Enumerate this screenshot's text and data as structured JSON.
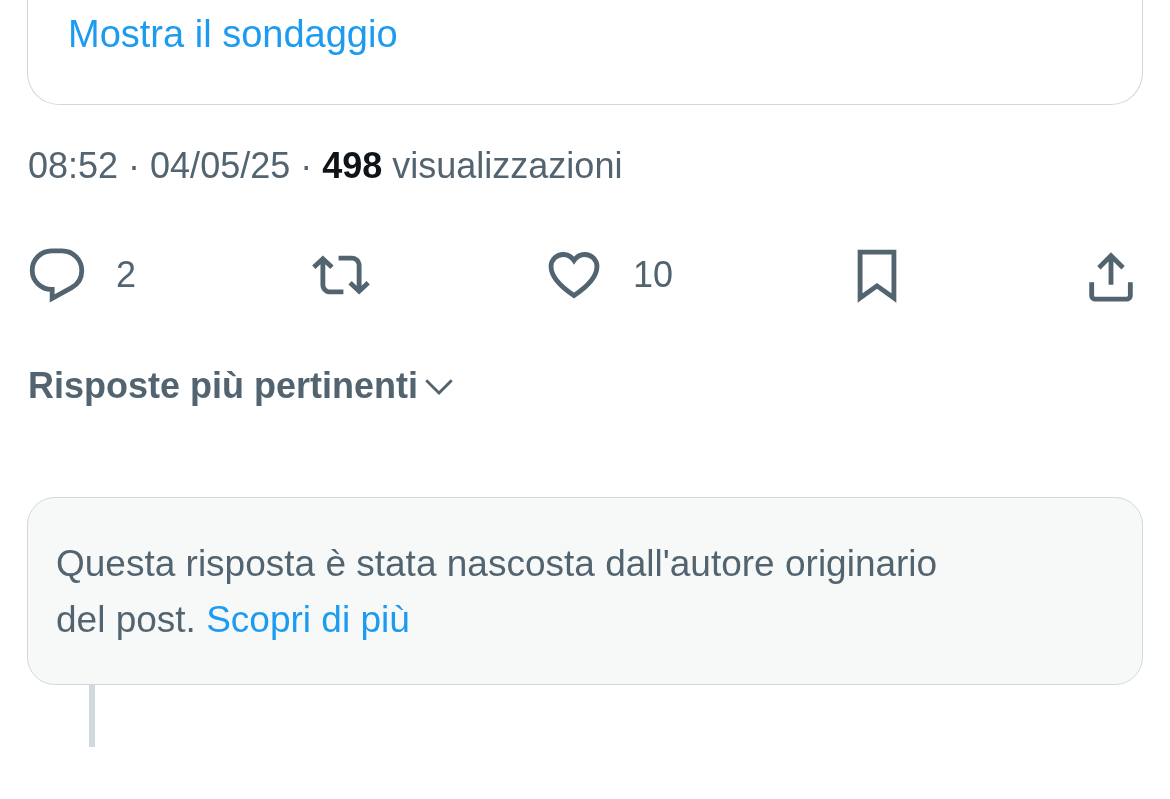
{
  "poll_card": {
    "link": "Mostra il sondaggio"
  },
  "meta": "08:52 · 04/05/25 · **498** visualizzazioni",
  "actions": [
    {
      "kind": "reply",
      "count": "2"
    },
    {
      "kind": "repost"
    },
    {
      "kind": "like",
      "count": "10"
    },
    {
      "kind": "bookmark"
    },
    {
      "kind": "share"
    }
  ],
  "sort": {
    "label": "Risposte più pertinenti"
  },
  "hidden_reply": {
    "text": "Questa risposta è stata nascosta dall'autore originario del post.",
    "link": "Scopri di più"
  }
}
